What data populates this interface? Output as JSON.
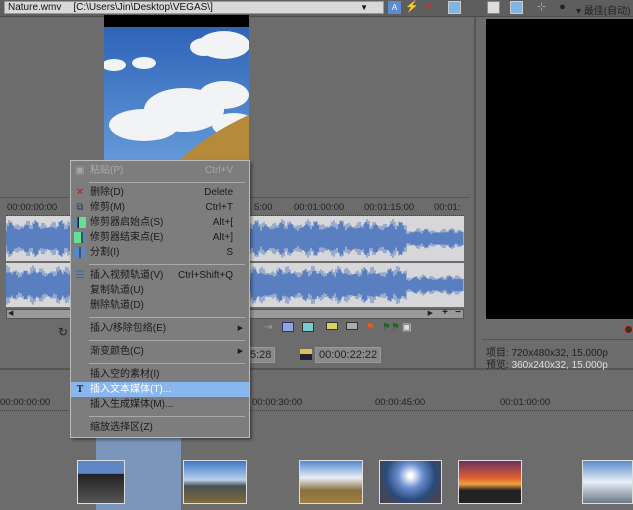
{
  "topbar": {
    "file_name": "Nature.wmv",
    "path": "[C:\\Users\\Jin\\Desktop\\VEGAS\\]",
    "quality": "最佳(自动)"
  },
  "upper_ruler": [
    "00:00:00:00",
    "5:00",
    "00:01:00:00",
    "00:01:15:00",
    "00:01:"
  ],
  "times": {
    "left_partial": "5:28",
    "selection_length": "00:00:22:22"
  },
  "lower_ruler": [
    "00:00:00:00",
    "00:00:30:00",
    "00:00:45:00",
    "00:01:00:00"
  ],
  "preview_info": {
    "project_label": "项目:",
    "project_value": "720x480x32, 15.000p",
    "preview_label": "预览:",
    "preview_value": "360x240x32, 15.000p"
  },
  "menu": [
    {
      "label": "粘贴(P)",
      "shortcut": "Ctrl+V",
      "disabled": true
    },
    {
      "label": "删除(D)",
      "shortcut": "Delete"
    },
    {
      "label": "修剪(M)",
      "shortcut": "Ctrl+T"
    },
    {
      "label": "修剪器启始点(S)",
      "shortcut": "Alt+["
    },
    {
      "label": "修剪器结束点(E)",
      "shortcut": "Alt+]"
    },
    {
      "label": "分割(I)",
      "shortcut": "S"
    },
    {
      "label": "插入视频轨道(V)",
      "shortcut": "Ctrl+Shift+Q"
    },
    {
      "label": "复制轨道(U)"
    },
    {
      "label": "删除轨道(D)"
    },
    {
      "label": "插入/移除包络(E)"
    },
    {
      "label": "渐变颜色(C)"
    },
    {
      "label": "插入空的素材(I)"
    },
    {
      "label": "插入文本媒体(T)...",
      "highlighted": true
    },
    {
      "label": "插入生成媒体(M)..."
    },
    {
      "label": "缩放选择区(Z)"
    }
  ],
  "colors": {
    "highlight": "#89b6ee",
    "waveform": "#5a7fc0"
  }
}
